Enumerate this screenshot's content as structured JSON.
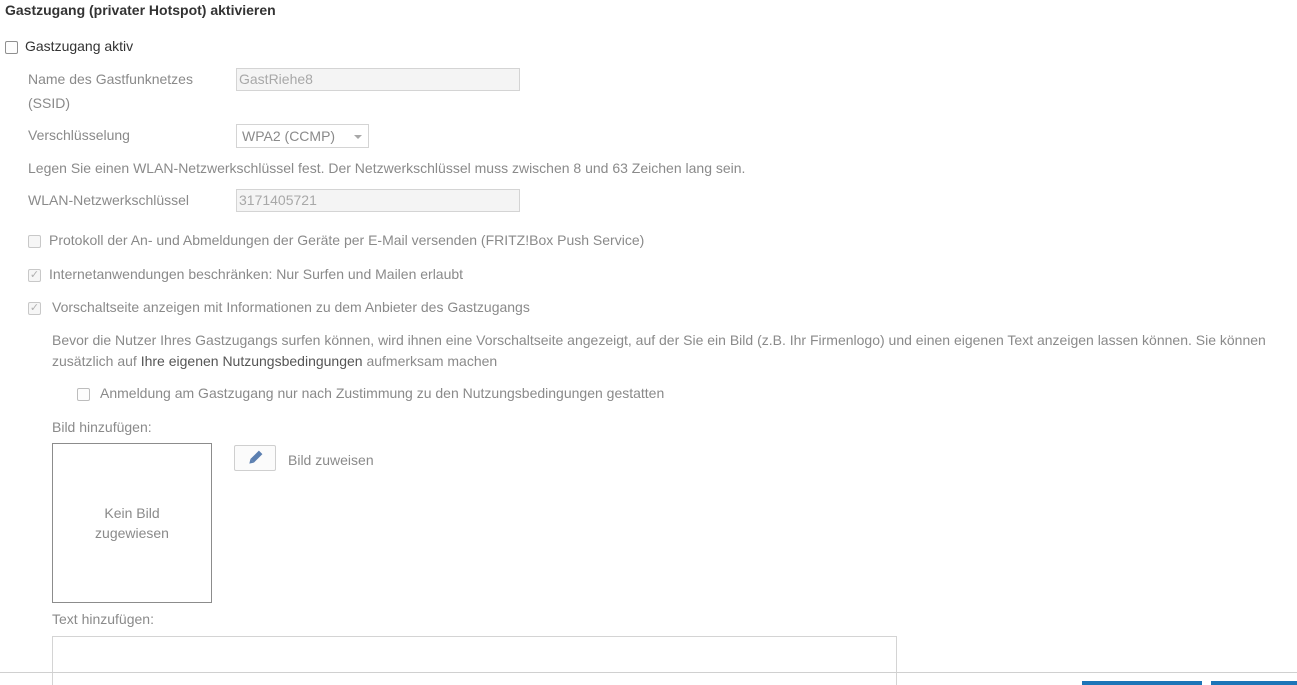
{
  "section": {
    "title": "Gastzugang (privater Hotspot) aktivieren"
  },
  "guest_access": {
    "enabled_label": "Gastzugang aktiv",
    "enabled_checked": false
  },
  "ssid": {
    "label_line1": "Name des Gastfunknetzes",
    "label_line2": "(SSID)",
    "value": "GastRiehe8"
  },
  "encryption": {
    "label": "Verschlüsselung",
    "selected": "WPA2 (CCMP)"
  },
  "key_hint": "Legen Sie einen WLAN-Netzwerkschlüssel fest. Der Netzwerkschlüssel muss zwischen 8 und 63 Zeichen lang sein.",
  "network_key": {
    "label": "WLAN-Netzwerkschlüssel",
    "value": "3171405721"
  },
  "options": {
    "push_service": {
      "label": "Protokoll der An- und Abmeldungen der Geräte per E-Mail versenden (FRITZ!Box Push Service)",
      "checked": false
    },
    "restrict_apps": {
      "label": "Internetanwendungen beschränken: Nur Surfen und Mailen erlaubt",
      "checked": true
    },
    "landing_page": {
      "label": "Vorschaltseite anzeigen mit Informationen zu dem Anbieter des Gastzugangs",
      "checked": true
    }
  },
  "landing": {
    "description_part1": "Bevor die Nutzer Ihres Gastzugangs surfen können, wird ihnen eine Vorschaltseite angezeigt, auf der Sie ein Bild (z.B. Ihr Firmenlogo) und einen eigenen Text anzeigen lassen können. Sie können zusätzlich auf ",
    "terms_link": "Ihre eigenen Nutzungsbedingungen",
    "description_part2": " aufmerksam machen",
    "consent_label": "Anmeldung am Gastzugang nur nach Zustimmung zu den Nutzungsbedingungen gestatten",
    "consent_checked": false,
    "add_image_label": "Bild hinzufügen:",
    "no_image_text": "Kein Bild zugewiesen",
    "assign_image_label": "Bild zuweisen",
    "edit_icon": "pencil-icon",
    "add_text_label": "Text hinzufügen:"
  },
  "colors": {
    "accent": "#1c75b8"
  }
}
